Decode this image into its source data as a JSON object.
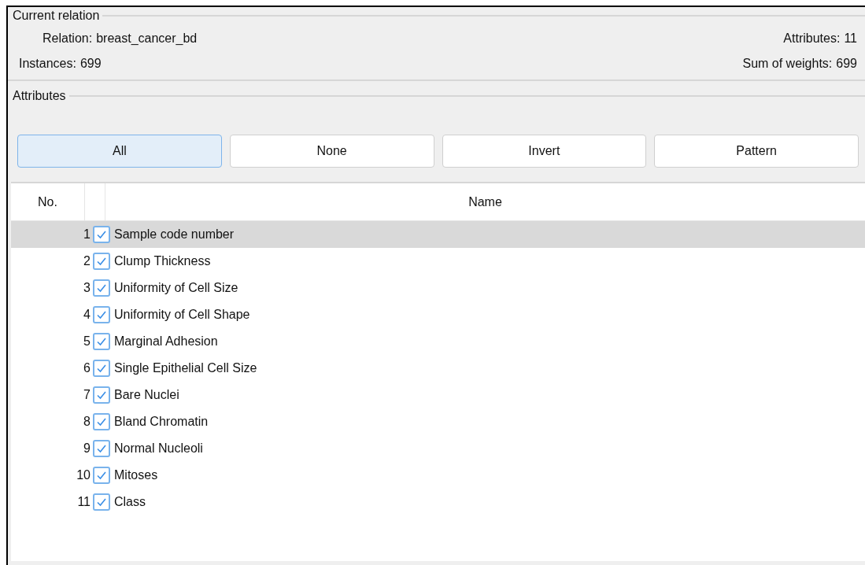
{
  "current_relation": {
    "title": "Current relation",
    "relation_label": "Relation:",
    "relation": "breast_cancer_bd",
    "instances_label": "Instances:",
    "instances": "699",
    "attributes_label": "Attributes:",
    "attributes": "11",
    "sum_label": "Sum of weights:",
    "sum": "699"
  },
  "attributes": {
    "title": "Attributes",
    "buttons": [
      {
        "label": "All",
        "focused": true
      },
      {
        "label": "None",
        "focused": false
      },
      {
        "label": "Invert",
        "focused": false
      },
      {
        "label": "Pattern",
        "focused": false
      }
    ],
    "table": {
      "columns": [
        "No.",
        "Name"
      ],
      "rows": [
        {
          "no": "1",
          "checked": true,
          "name": "Sample code number",
          "selected": true
        },
        {
          "no": "2",
          "checked": true,
          "name": "Clump Thickness",
          "selected": false
        },
        {
          "no": "3",
          "checked": true,
          "name": "Uniformity of Cell Size",
          "selected": false
        },
        {
          "no": "4",
          "checked": true,
          "name": "Uniformity of Cell Shape",
          "selected": false
        },
        {
          "no": "5",
          "checked": true,
          "name": "Marginal Adhesion",
          "selected": false
        },
        {
          "no": "6",
          "checked": true,
          "name": "Single Epithelial Cell Size",
          "selected": false
        },
        {
          "no": "7",
          "checked": true,
          "name": "Bare Nuclei",
          "selected": false
        },
        {
          "no": "8",
          "checked": true,
          "name": "Bland Chromatin",
          "selected": false
        },
        {
          "no": "9",
          "checked": true,
          "name": "Normal Nucleoli",
          "selected": false
        },
        {
          "no": "10",
          "checked": true,
          "name": "Mitoses",
          "selected": false
        },
        {
          "no": "11",
          "checked": true,
          "name": "Class",
          "selected": false
        }
      ]
    }
  }
}
